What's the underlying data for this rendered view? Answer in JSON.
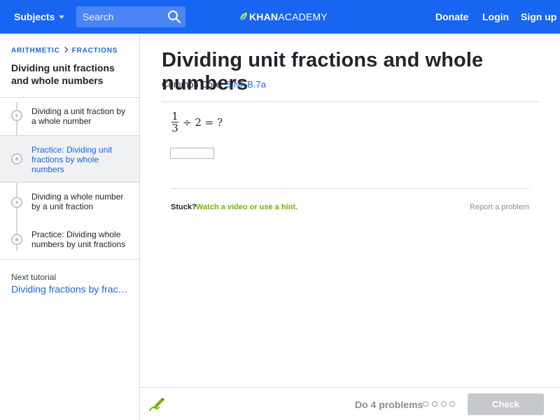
{
  "nav": {
    "subjects_label": "Subjects",
    "search_placeholder": "Search",
    "logo_bold": "KHAN",
    "logo_light": "ACADEMY",
    "donate_label": "Donate",
    "login_label": "Login",
    "signup_label": "Sign up"
  },
  "sidebar": {
    "breadcrumb": [
      "ARITHMETIC",
      "FRACTIONS"
    ],
    "tutorial_title": "Dividing unit fractions and whole numbers",
    "items": [
      {
        "label": "Dividing a unit fraction by a whole number",
        "type": "video",
        "active": false
      },
      {
        "label": "Practice: Dividing unit fractions by whole numbers",
        "type": "practice",
        "active": true
      },
      {
        "label": "Dividing a whole number by a unit fraction",
        "type": "video",
        "active": false
      },
      {
        "label": "Practice: Dividing whole numbers by unit fractions",
        "type": "practice",
        "active": false
      }
    ],
    "next_label": "Next tutorial",
    "next_link": "Dividing fractions by fractions"
  },
  "main": {
    "title": "Dividing unit fractions and whole numbers",
    "common_core_label": "Common Core:",
    "common_core_code": "5.NF.B.7a",
    "problem": {
      "numerator": "1",
      "denominator": "3",
      "rest": "÷ 2 = ?"
    },
    "answer_value": "",
    "stuck_label": "Stuck?",
    "hint_link": "Watch a video or use a hint.",
    "report_link": "Report a problem"
  },
  "footer": {
    "do_problems": "Do 4 problems",
    "progress_completed": 0,
    "progress_total": 4,
    "check_label": "Check"
  },
  "colors": {
    "brand_blue": "#1865f2",
    "hint_green": "#71b307",
    "disabled_gray": "#c6c9cc"
  }
}
